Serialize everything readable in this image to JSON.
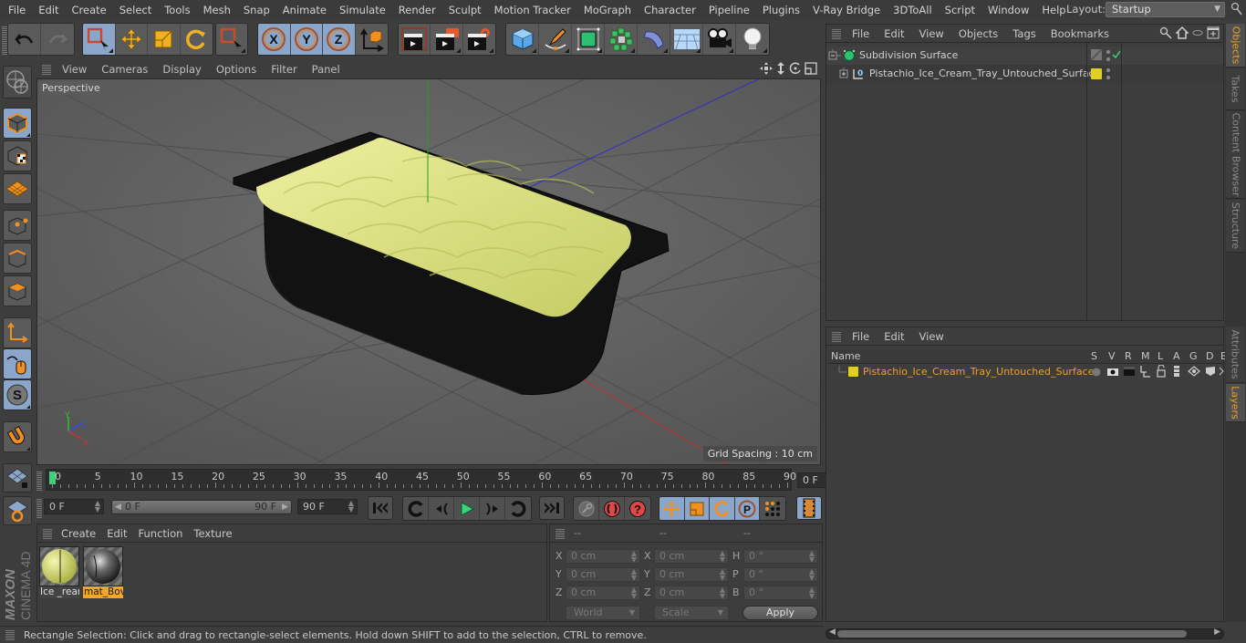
{
  "menubar": {
    "items": [
      "File",
      "Edit",
      "Create",
      "Select",
      "Tools",
      "Mesh",
      "Snap",
      "Animate",
      "Simulate",
      "Render",
      "Sculpt",
      "Motion Tracker",
      "MoGraph",
      "Character",
      "Pipeline",
      "Plugins",
      "V-Ray Bridge",
      "3DToAll",
      "Script",
      "Window",
      "Help"
    ],
    "layout_label": "Layout:",
    "layout_value": "Startup"
  },
  "toolbar": {
    "groups": [
      {
        "name": "history",
        "buttons": [
          "undo",
          "redo"
        ]
      },
      {
        "name": "tools",
        "buttons": [
          "rectangle-selection",
          "move",
          "scale",
          "rotate"
        ]
      },
      {
        "name": "selection-filter",
        "buttons": [
          "live-selection"
        ]
      },
      {
        "name": "axis",
        "buttons": [
          "x-axis",
          "y-axis",
          "z-axis",
          "coordinate-system"
        ]
      },
      {
        "name": "render",
        "buttons": [
          "render-view",
          "render-picture-viewer",
          "render-settings"
        ]
      },
      {
        "name": "create",
        "buttons": [
          "cube",
          "pen",
          "subdivision-surface",
          "cloner",
          "bend-deformer",
          "floor",
          "camera",
          "light"
        ]
      }
    ]
  },
  "viewport": {
    "menu": [
      "View",
      "Cameras",
      "Display",
      "Options",
      "Filter",
      "Panel"
    ],
    "camera_label": "Perspective",
    "grid_spacing": "Grid Spacing : 10 cm",
    "axis_labels": {
      "x": "X",
      "y": "Y",
      "z": "Z"
    }
  },
  "left_tools": [
    "make-editable",
    "texture-mode",
    "workplane-mode",
    "points-mode",
    "edges-mode",
    "polygons-mode",
    "axis-mode",
    "tweak-mode",
    "solo-mode",
    "snap-mode"
  ],
  "timeline": {
    "ticks": [
      "0",
      "5",
      "10",
      "15",
      "20",
      "25",
      "30",
      "35",
      "40",
      "45",
      "50",
      "55",
      "60",
      "65",
      "70",
      "75",
      "80",
      "85",
      "90"
    ],
    "current_frame": "0 F",
    "start_field": "0 F",
    "range_start": "0 F",
    "range_end": "90 F",
    "end_field": "90 F",
    "playhead_frame": 0,
    "max_frame": 90
  },
  "materials": {
    "menu": [
      "Create",
      "Edit",
      "Function",
      "Texture"
    ],
    "items": [
      {
        "name": "Ice _rear",
        "selected": false,
        "color": "#d4de7a"
      },
      {
        "name": "mat_Bov",
        "selected": true,
        "color": "#3a3a3a"
      }
    ]
  },
  "coordinates": {
    "headers": [
      "--",
      "--",
      "--"
    ],
    "rows": [
      {
        "l1": "X",
        "v1": "0 cm",
        "l2": "X",
        "v2": "0 cm",
        "l3": "H",
        "v3": "0 °"
      },
      {
        "l1": "Y",
        "v1": "0 cm",
        "l2": "Y",
        "v2": "0 cm",
        "l3": "P",
        "v3": "0 °"
      },
      {
        "l1": "Z",
        "v1": "0 cm",
        "l2": "Z",
        "v2": "0 cm",
        "l3": "B",
        "v3": "0 °"
      }
    ],
    "space_dropdown": "World",
    "mode_dropdown": "Scale",
    "apply_label": "Apply"
  },
  "brand": {
    "line1": "MAXON",
    "line2": "CINEMA 4D"
  },
  "status": {
    "text": "Rectangle Selection: Click and drag to rectangle-select elements. Hold down SHIFT to add to the selection, CTRL to remove."
  },
  "objects_panel": {
    "menu": [
      "File",
      "Edit",
      "View",
      "Objects",
      "Tags",
      "Bookmarks"
    ],
    "rows": [
      {
        "name": "Subdivision Surface",
        "layer_color": null
      },
      {
        "name": "Pistachio_Ice_Cream_Tray_Untouched_Surface",
        "layer_color": "#e0d020"
      }
    ]
  },
  "layers_panel": {
    "menu": [
      "File",
      "Edit",
      "View"
    ],
    "columns": [
      "Name",
      "S",
      "V",
      "R",
      "M",
      "L",
      "A",
      "G",
      "D",
      "E"
    ],
    "rows": [
      {
        "name": "Pistachio_Ice_Cream_Tray_Untouched_Surface",
        "color": "#e0d020"
      }
    ]
  },
  "right_tabs": {
    "top": [
      {
        "label": "Objects",
        "active": true
      },
      {
        "label": "Takes",
        "active": false
      },
      {
        "label": "Content Browser",
        "active": false
      },
      {
        "label": "Structure",
        "active": false
      }
    ],
    "bottom": [
      {
        "label": "Attributes",
        "active": false
      },
      {
        "label": "Layers",
        "active": true
      }
    ]
  },
  "colors": {
    "accent_orange": "#f5a623",
    "active_blue": "#8aa6cb",
    "layer_yellow": "#e0d020"
  }
}
